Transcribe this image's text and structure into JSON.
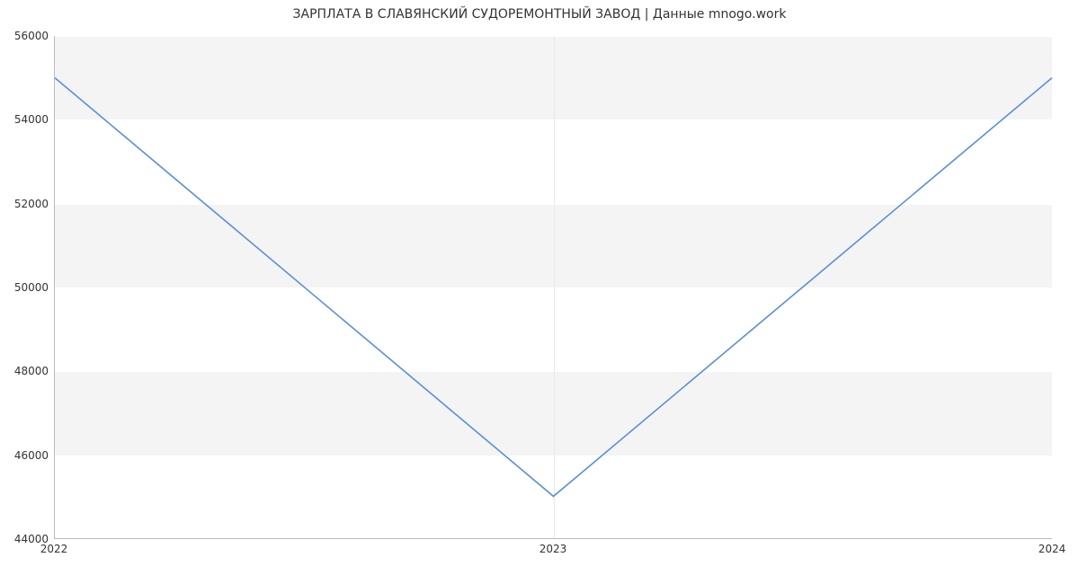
{
  "chart_data": {
    "type": "line",
    "title": "ЗАРПЛАТА В  СЛАВЯНСКИЙ СУДОРЕМОНТНЫЙ ЗАВОД | Данные mnogo.work",
    "x": [
      "2022",
      "2023",
      "2024"
    ],
    "values": [
      55000,
      45000,
      55000
    ],
    "xlabel": "",
    "ylabel": "",
    "y_ticks": [
      44000,
      46000,
      48000,
      50000,
      52000,
      54000,
      56000
    ],
    "ylim": [
      44000,
      56000
    ],
    "line_color": "#5a8fd6"
  }
}
